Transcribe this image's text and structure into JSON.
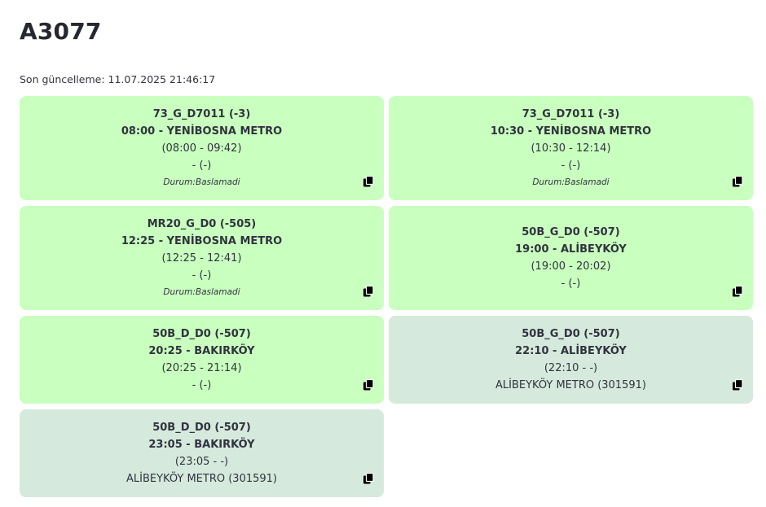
{
  "page": {
    "title": "A3077",
    "updated": "Son güncelleme: 11.07.2025 21:46:17"
  },
  "trips": [
    {
      "route": "73_G_D7011 (-3)",
      "departure": "08:00 - YENİBOSNA METRO",
      "window": "(08:00 - 09:42)",
      "extra": "- (-)",
      "status": "Durum:Baslamadi"
    },
    {
      "route": "73_G_D7011 (-3)",
      "departure": "10:30 - YENİBOSNA METRO",
      "window": "(10:30 - 12:14)",
      "extra": "- (-)",
      "status": "Durum:Baslamadi"
    },
    {
      "route": "MR20_G_D0 (-505)",
      "departure": "12:25 - YENİBOSNA METRO",
      "window": "(12:25 - 12:41)",
      "extra": "- (-)",
      "status": "Durum:Baslamadi"
    },
    {
      "route": "50B_G_D0 (-507)",
      "departure": "19:00 - ALİBEYKÖY",
      "window": "(19:00 - 20:02)",
      "extra": "- (-)"
    },
    {
      "route": "50B_D_D0 (-507)",
      "departure": "20:25 - BAKIRKÖY",
      "window": "(20:25 - 21:14)",
      "extra": "- (-)"
    },
    {
      "route": "50B_G_D0 (-507)",
      "departure": "22:10 - ALİBEYKÖY",
      "window": "(22:10 - -)",
      "extra": "ALİBEYKÖY METRO (301591)"
    },
    {
      "route": "50B_D_D0 (-507)",
      "departure": "23:05 - BAKIRKÖY",
      "window": "(23:05 - -)",
      "extra": "ALİBEYKÖY METRO (301591)"
    }
  ],
  "colors": {
    "card_active": "#c9ffbf",
    "card_other": "#d6e9dd",
    "text": "#31333f"
  },
  "icons": {
    "copy": "copy-icon"
  }
}
